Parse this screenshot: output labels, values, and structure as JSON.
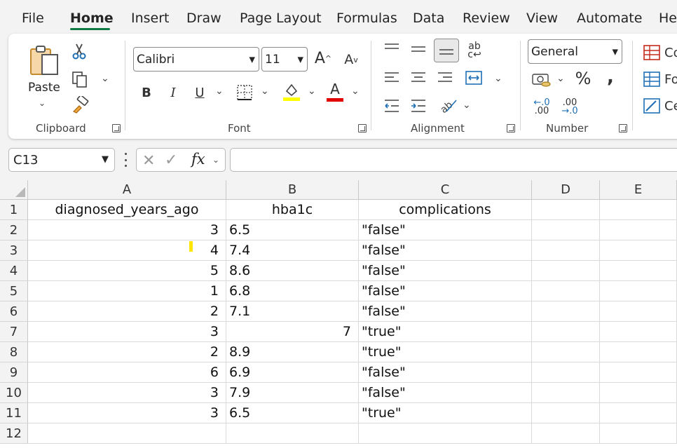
{
  "menu": {
    "tabs": [
      "File",
      "Home",
      "Insert",
      "Draw",
      "Page Layout",
      "Formulas",
      "Data",
      "Review",
      "View",
      "Automate",
      "Help"
    ],
    "active": "Home"
  },
  "ribbon": {
    "clipboard": {
      "label": "Clipboard",
      "paste_label": "Paste"
    },
    "font": {
      "label": "Font",
      "font_name": "Calibri",
      "font_size": "11",
      "bold": "B",
      "italic": "I",
      "underline": "U",
      "font_color_glyph": "A",
      "grow_glyph": "A",
      "shrink_glyph": "A",
      "fill_color": "#ffff00",
      "text_color": "#e00000"
    },
    "alignment": {
      "label": "Alignment",
      "wrap_glyph": "ab"
    },
    "number": {
      "label": "Number",
      "format": "General",
      "percent": "%",
      "comma": ",",
      "inc_decimal_top": "←.0",
      "inc_decimal_bottom": ".00",
      "dec_decimal_top": ".00",
      "dec_decimal_bottom": "→.0"
    },
    "styles": {
      "items": [
        "Co",
        "Fo",
        "Ce"
      ]
    }
  },
  "formula_bar": {
    "name_box": "C13",
    "fx": "fx",
    "formula": ""
  },
  "sheet": {
    "columns": [
      "A",
      "B",
      "C",
      "D",
      "E"
    ],
    "rows": [
      {
        "num": "1",
        "a": "diagnosed_years_ago",
        "b": "hba1c",
        "c": "complications"
      },
      {
        "num": "2",
        "a": "3",
        "b": "6.5",
        "c": "\"false\""
      },
      {
        "num": "3",
        "a": "4",
        "b": "7.4",
        "c": "\"false\""
      },
      {
        "num": "4",
        "a": "5",
        "b": "8.6",
        "c": "\"false\""
      },
      {
        "num": "5",
        "a": "1",
        "b": "6.8",
        "c": "\"false\""
      },
      {
        "num": "6",
        "a": "2",
        "b": "7.1",
        "c": "\"false\""
      },
      {
        "num": "7",
        "a": "3",
        "b": "7",
        "c": "\"true\""
      },
      {
        "num": "8",
        "a": "2",
        "b": "8.9",
        "c": "\"true\""
      },
      {
        "num": "9",
        "a": "6",
        "b": "6.9",
        "c": "\"false\""
      },
      {
        "num": "10",
        "a": "3",
        "b": "7.9",
        "c": "\"false\""
      },
      {
        "num": "11",
        "a": "3",
        "b": "6.5",
        "c": "\"true\""
      },
      {
        "num": "12",
        "a": "",
        "b": "",
        "c": ""
      }
    ],
    "right_aligned_b_rows": [
      6
    ]
  }
}
